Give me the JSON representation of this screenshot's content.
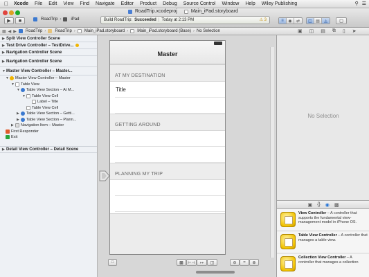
{
  "menubar": {
    "items": [
      "Xcode",
      "File",
      "Edit",
      "View",
      "Find",
      "Navigate",
      "Editor",
      "Product",
      "Debug",
      "Source Control",
      "Window",
      "Help",
      "Wiley Publishing"
    ]
  },
  "toolbar": {
    "tab_project": "RoadTrip.xcodeproj",
    "tab_storyboard": "Main_iPad.storyboard",
    "scheme": "RoadTrip",
    "destination": "iPad",
    "status_prefix": "Build RoadTrip:",
    "status_state": "Succeeded",
    "status_time": "Today at 2:13 PM",
    "warning_count": "3"
  },
  "jumpbar": {
    "crumbs": [
      "RoadTrip",
      "RoadTrip",
      "Main_iPad.storyboard",
      "Main_iPad.storyboard (Base)",
      "No Selection"
    ]
  },
  "outline": {
    "scenes": [
      "Split View Controller Scene",
      "Test Drive Controller – TestDrive...",
      "Navigation Controller Scene",
      "Navigation Controller Scene",
      "Master View Controller – Master...",
      "Detail View Controller – Detail Scene"
    ],
    "nodes": [
      "Master View Controller – Master",
      "Table View",
      "Table View Section – At M...",
      "Table View Cell",
      "Label – Title",
      "Table View Cell",
      "Table View Section – Getti...",
      "Table View Section – Plann...",
      "Navigation Item – Master",
      "First Responder",
      "Exit"
    ]
  },
  "canvas": {
    "nav_title": "Master",
    "sections": [
      "AT MY DESTINATION",
      "GETTING AROUND",
      "PLANNING MY TRIP"
    ],
    "cell_title": "Title"
  },
  "utilities": {
    "no_selection": "No Selection",
    "library": [
      {
        "name": "View Controller",
        "desc": " – A controller that supports the fundamental view-management model in iPhone OS."
      },
      {
        "name": "Table View Controller",
        "desc": " – A controller that manages a table view."
      },
      {
        "name": "Collection View Controller",
        "desc": " – A controller that manages a collection"
      }
    ]
  },
  "colors": {
    "accent": "#1d6fd6",
    "library_icon": "#f2c300",
    "scene_icon": "#f0b400"
  }
}
